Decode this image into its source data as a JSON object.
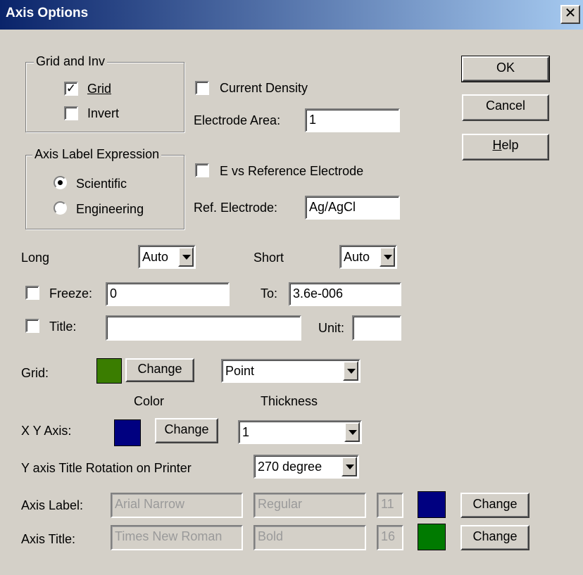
{
  "window": {
    "title": "Axis Options",
    "close_glyph": "✕"
  },
  "buttons": {
    "ok": "OK",
    "cancel": "Cancel",
    "help": "Help"
  },
  "grid_inv": {
    "legend": "Grid and Inv",
    "grid_label": "Grid",
    "grid_checked": true,
    "invert_label": "Invert",
    "invert_checked": false
  },
  "axis_label_expression": {
    "legend": "Axis Label Expression",
    "scientific_label": "Scientific",
    "scientific_selected": true,
    "engineering_label": "Engineering",
    "engineering_selected": false
  },
  "current_density": {
    "label": "Current Density",
    "checked": false
  },
  "electrode_area": {
    "label": "Electrode Area:",
    "value": "1"
  },
  "e_vs_ref": {
    "label": "E vs Reference Electrode",
    "checked": false
  },
  "ref_electrode": {
    "label": "Ref. Electrode:",
    "value": "Ag/AgCl"
  },
  "long": {
    "label": "Long",
    "value": "Auto"
  },
  "short": {
    "label": "Short",
    "value": "Auto"
  },
  "freeze": {
    "label": "Freeze:",
    "checked": false,
    "value": "0"
  },
  "to": {
    "label": "To:",
    "value": "3.6e-006"
  },
  "title_field": {
    "label": "Title:",
    "checked": false,
    "value": ""
  },
  "unit": {
    "label": "Unit:",
    "value": ""
  },
  "grid_style": {
    "label": "Grid:",
    "color": "#3a7d00",
    "change_label": "Change",
    "line_style": "Point"
  },
  "column_headers": {
    "color": "Color",
    "thickness": "Thickness"
  },
  "xy_axis": {
    "label": "X Y Axis:",
    "color": "#000080",
    "change_label": "Change",
    "thickness": "1"
  },
  "y_rotation": {
    "label": "Y axis Title Rotation on Printer",
    "value": "270 degree"
  },
  "axis_label_font": {
    "label": "Axis Label:",
    "font": "Arial Narrow",
    "style": "Regular",
    "size": "11",
    "color": "#000080",
    "change_label": "Change"
  },
  "axis_title_font": {
    "label": "Axis Title:",
    "font": "Times New Roman",
    "style": "Bold",
    "size": "16",
    "color": "#007a00",
    "change_label": "Change"
  }
}
